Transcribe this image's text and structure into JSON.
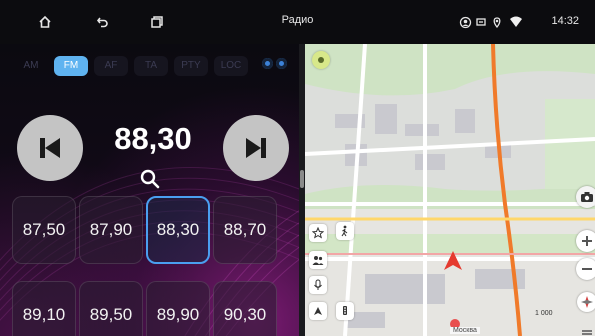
{
  "statusbar": {
    "title": "Радио",
    "time": "14:32",
    "icons": [
      "home-icon",
      "back-icon",
      "recent-apps-icon",
      "account-icon",
      "sim-icon",
      "location-icon",
      "wifi-icon"
    ]
  },
  "radio": {
    "bands": [
      {
        "label": "AM",
        "active": false
      },
      {
        "label": "FM",
        "active": true
      },
      {
        "label": "AF",
        "active": false
      },
      {
        "label": "TA",
        "active": false
      },
      {
        "label": "PTY",
        "active": false
      },
      {
        "label": "LOC",
        "active": false
      }
    ],
    "current_frequency": "88,30",
    "presets": [
      "87,50",
      "87,90",
      "88,30",
      "88,70",
      "89,10",
      "89,50",
      "89,90",
      "90,30"
    ],
    "active_preset_index": 2,
    "accent_color": "#5fb3f0"
  },
  "map": {
    "scale": "1 000",
    "street": "Москва"
  }
}
